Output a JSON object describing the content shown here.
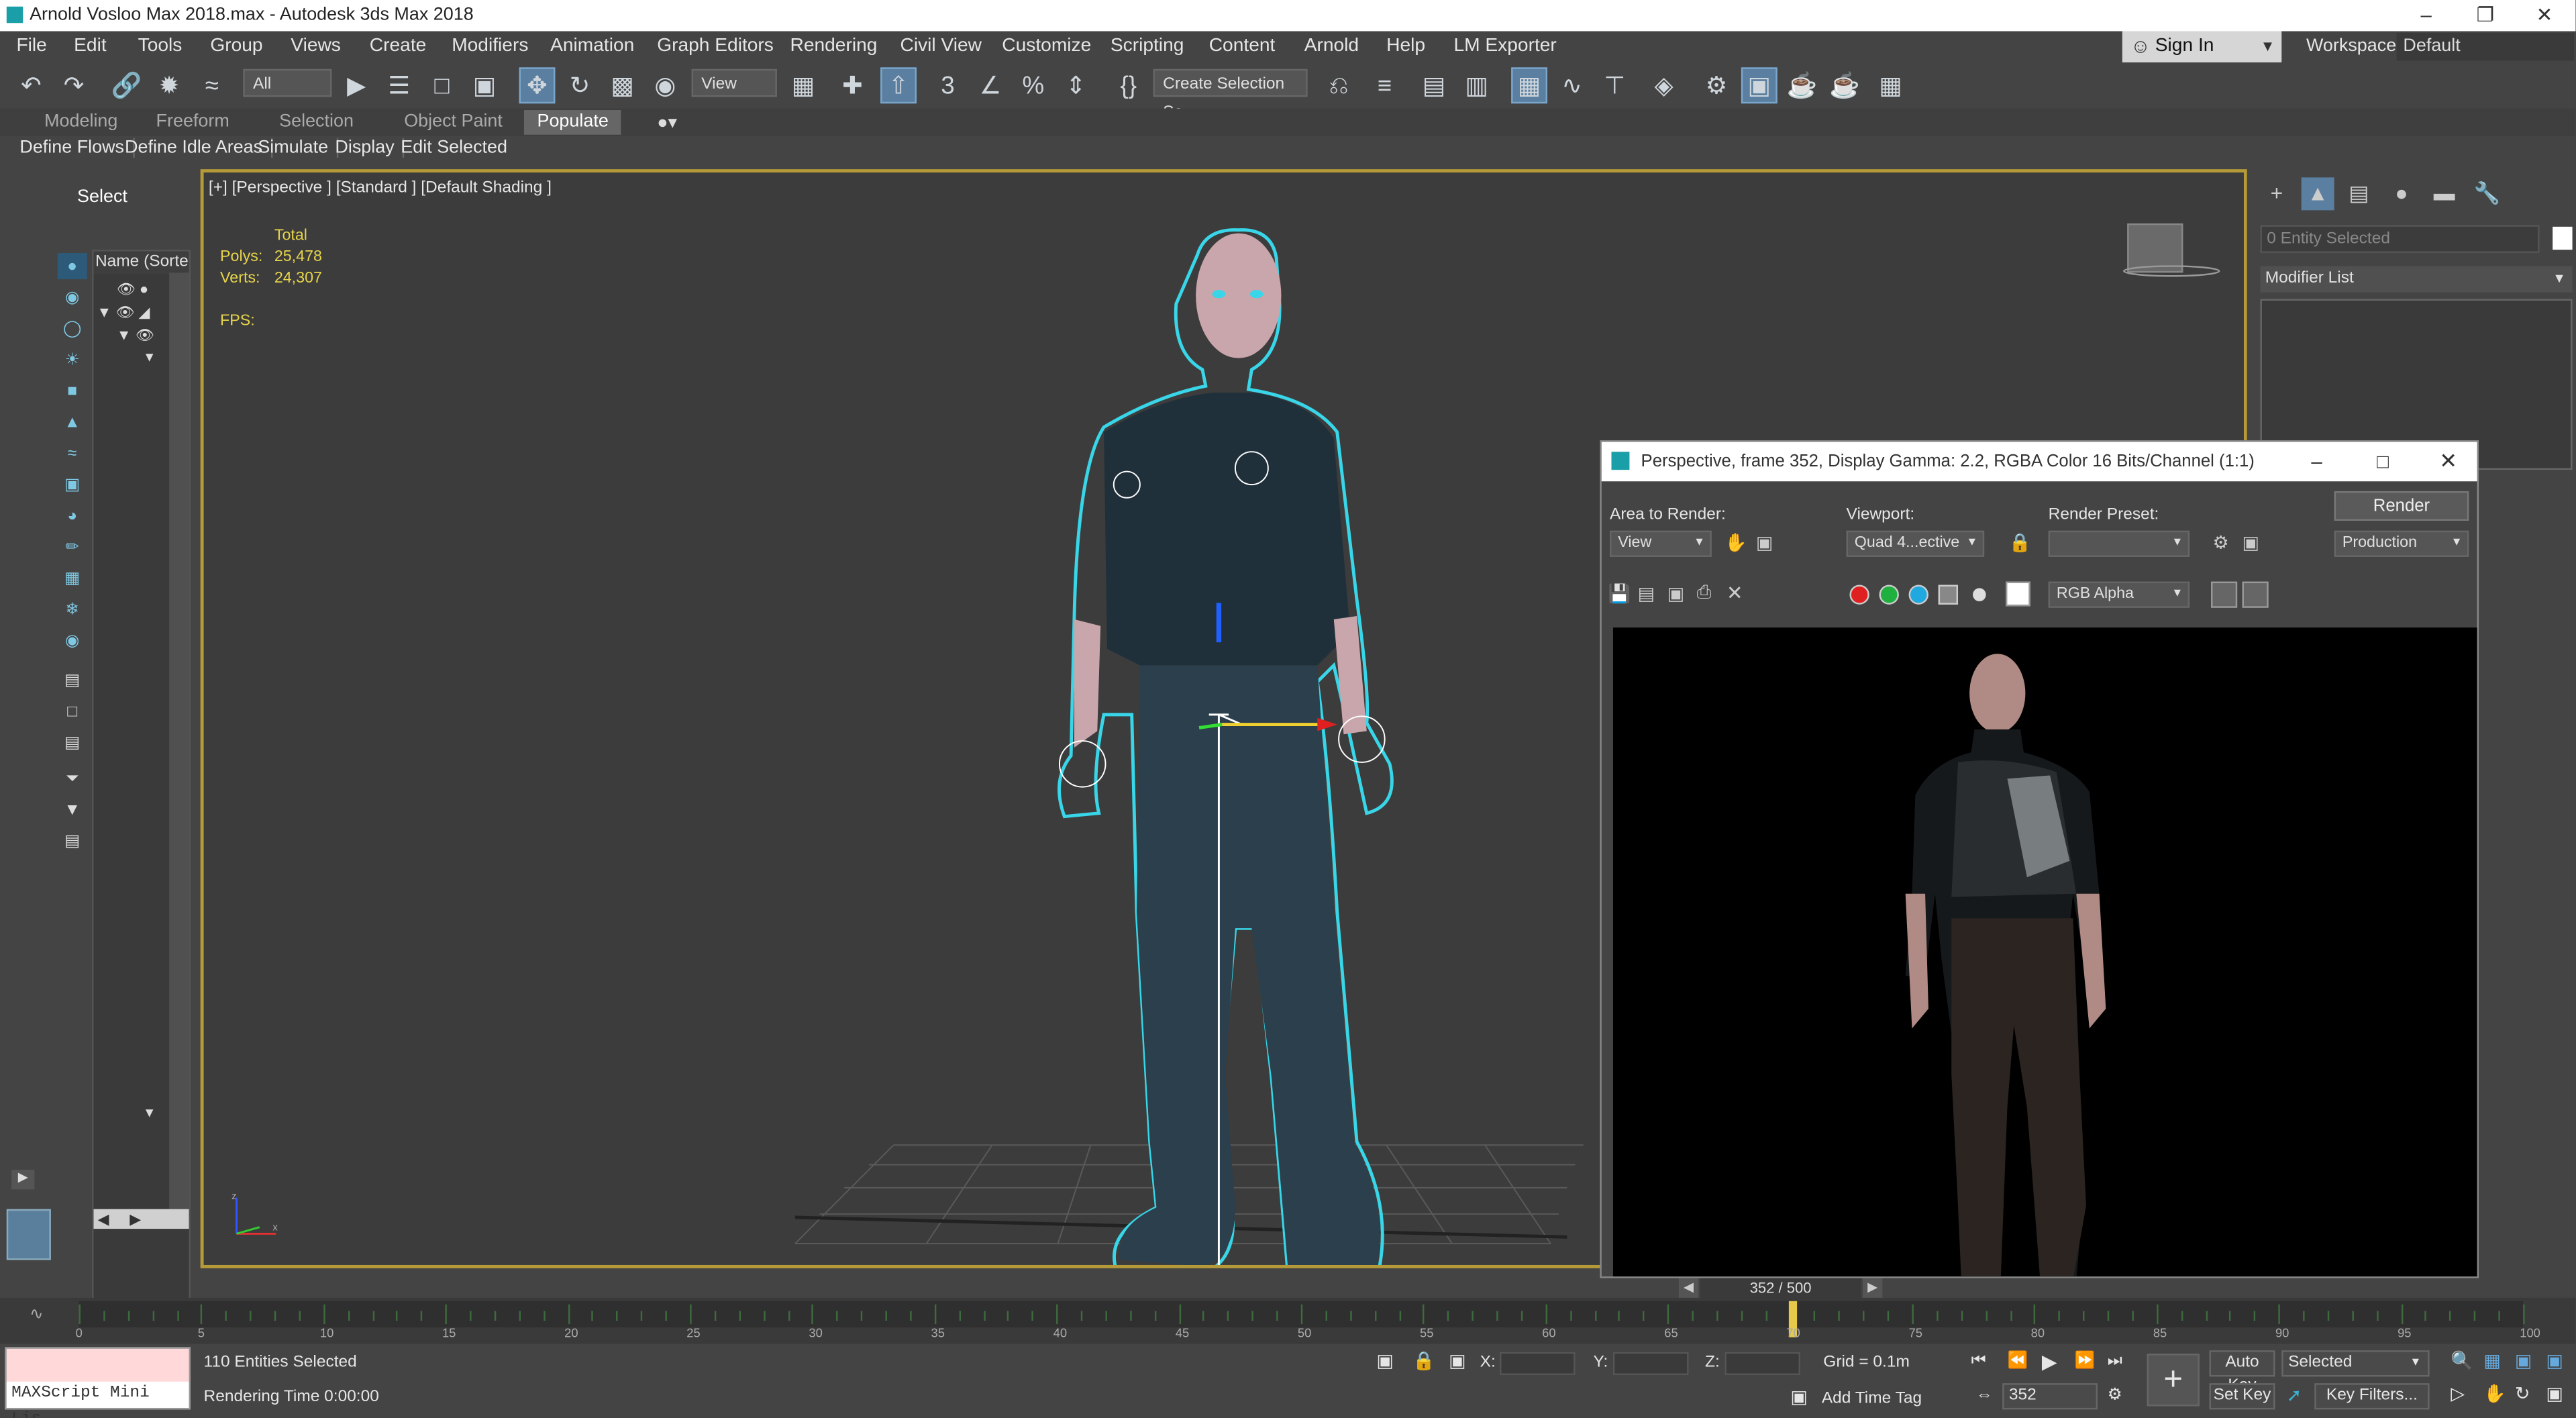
{
  "window": {
    "title": "Arnold Vosloo Max 2018.max - Autodesk 3ds Max 2018"
  },
  "menu": [
    "File",
    "Edit",
    "Tools",
    "Group",
    "Views",
    "Create",
    "Modifiers",
    "Animation",
    "Graph Editors",
    "Rendering",
    "Civil View",
    "Customize",
    "Scripting",
    "Content",
    "Arnold",
    "Help",
    "LM Exporter"
  ],
  "account": {
    "sign_in": "Sign In",
    "workspaces_label": "Workspaces:",
    "workspace_value": "Default"
  },
  "toolbar": {
    "filter_value": "All",
    "refcoord_value": "View",
    "selection_set_value": "Create Selection Se"
  },
  "ribbon": {
    "tabs": [
      "Modeling",
      "Freeform",
      "Selection",
      "Object Paint",
      "Populate"
    ],
    "selected_tab": "Populate",
    "buttons": [
      "Define Flows",
      "Define Idle Areas",
      "Simulate",
      "Display",
      "Edit Selected"
    ]
  },
  "scene_explorer": {
    "select_label": "Select",
    "column_header": "Name (Sorted A"
  },
  "viewport": {
    "label": "[+] [Perspective ] [Standard ] [Default Shading ]",
    "stats": {
      "total_label": "Total",
      "polys_label": "Polys:",
      "polys_value": "25,478",
      "verts_label": "Verts:",
      "verts_value": "24,307",
      "fps_label": "FPS:"
    }
  },
  "render_window": {
    "title": "Perspective, frame 352, Display Gamma: 2.2, RGBA Color 16 Bits/Channel (1:1)",
    "area_label": "Area to Render:",
    "area_value": "View",
    "viewport_label": "Viewport:",
    "viewport_value": "Quad 4...ective",
    "preset_label": "Render Preset:",
    "preset_value": "",
    "render_button": "Render",
    "production_value": "Production",
    "channel_value": "RGB Alpha",
    "frame_counter": "352 / 500"
  },
  "command_panel": {
    "entity_field": "0 Entity Selected",
    "modifier_list": "Modifier List"
  },
  "timeline": {
    "ticks": [
      "0",
      "5",
      "10",
      "15",
      "20",
      "25",
      "30",
      "35",
      "40",
      "45",
      "50",
      "55",
      "60",
      "65",
      "70",
      "75",
      "80",
      "85",
      "90",
      "95",
      "100"
    ]
  },
  "status": {
    "maxscript_placeholder": "MAXScript Mini Lis",
    "entities": "110 Entities Selected",
    "render_time": "Rendering Time 0:00:00",
    "x_label": "X:",
    "y_label": "Y:",
    "z_label": "Z:",
    "grid": "Grid = 0.1m",
    "add_time_tag": "Add Time Tag",
    "auto_key": "Auto Key",
    "set_key": "Set Key",
    "selected_value": "Selected",
    "key_filters": "Key Filters...",
    "current_frame": "352"
  },
  "colors": {
    "accent": "#b59a3a",
    "selection_outline": "#38d6e8",
    "stats_text": "#e6d44a"
  }
}
